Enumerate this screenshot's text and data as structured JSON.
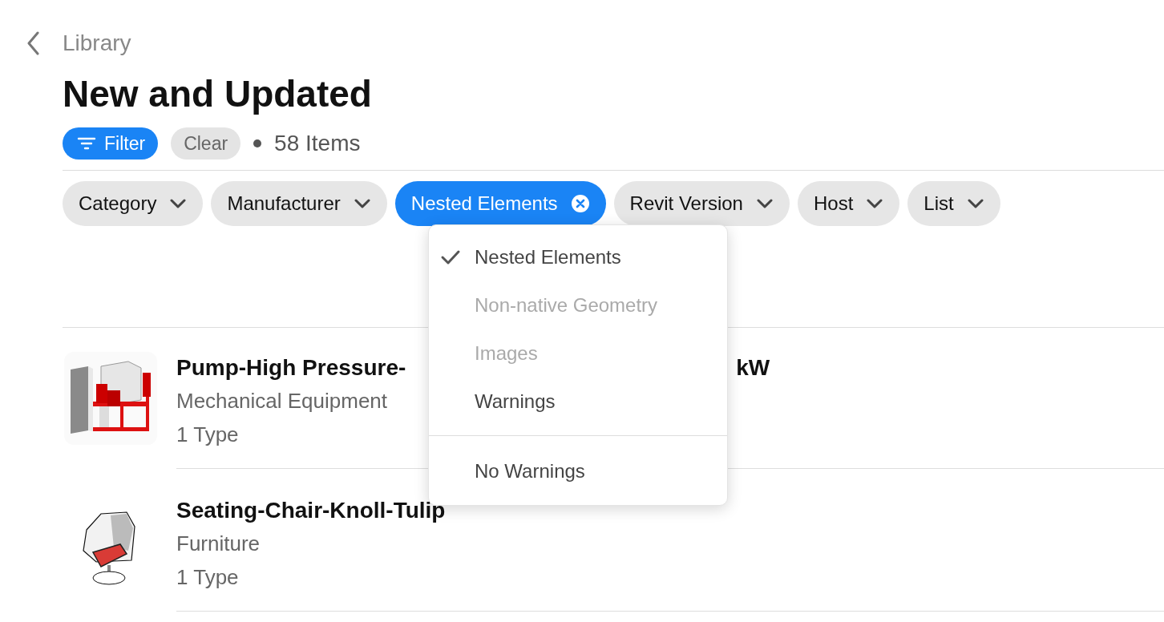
{
  "nav": {
    "back_label": "Library"
  },
  "title": "New and Updated",
  "toolbar": {
    "filter_label": "Filter",
    "clear_label": "Clear",
    "count": "58 Items"
  },
  "chips": [
    {
      "label": "Category",
      "selected": false
    },
    {
      "label": "Manufacturer",
      "selected": false
    },
    {
      "label": "Nested Elements",
      "selected": true
    },
    {
      "label": "Revit Version",
      "selected": false
    },
    {
      "label": "Host",
      "selected": false
    },
    {
      "label": "List",
      "selected": false
    }
  ],
  "dropdown": {
    "groups": [
      [
        {
          "label": "Nested Elements",
          "checked": true,
          "disabled": false
        },
        {
          "label": "Non-native Geometry",
          "checked": false,
          "disabled": true
        },
        {
          "label": "Images",
          "checked": false,
          "disabled": true
        },
        {
          "label": "Warnings",
          "checked": false,
          "disabled": false
        }
      ],
      [
        {
          "label": "No Warnings",
          "checked": false,
          "disabled": false
        }
      ]
    ]
  },
  "items": [
    {
      "title": "Pump-High Pressure-",
      "title_tail": "kW",
      "category": "Mechanical Equipment",
      "types": "1 Type"
    },
    {
      "title": "Seating-Chair-Knoll-Tulip",
      "category": "Furniture",
      "types": "1 Type"
    }
  ]
}
